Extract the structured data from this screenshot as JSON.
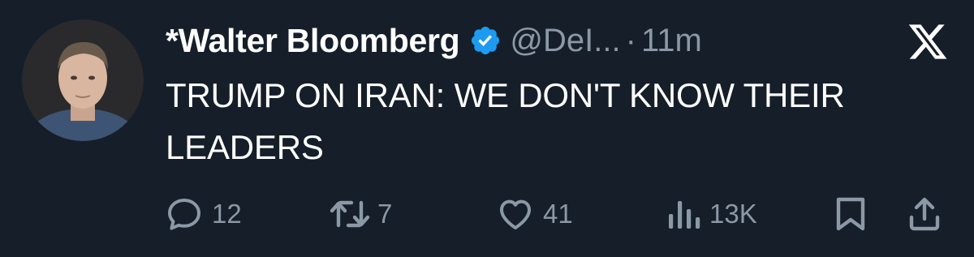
{
  "tweet": {
    "display_name": "*Walter Bloomberg",
    "handle": "@DeI...",
    "separator": "·",
    "time": "11m",
    "text": "TRUMP ON IRAN: WE DON'T KNOW THEIR LEADERS",
    "verified": true
  },
  "actions": {
    "replies": "12",
    "reposts": "7",
    "likes": "41",
    "views": "13K"
  },
  "icons": {
    "reply": "speech-bubble-icon",
    "repost": "repost-arrows-icon",
    "like": "heart-icon",
    "views": "bar-chart-icon",
    "bookmark": "bookmark-icon",
    "share": "share-upload-icon",
    "platform": "x-logo-icon",
    "verified": "verified-badge-icon"
  },
  "colors": {
    "background": "#151e29",
    "text_primary": "#ffffff",
    "text_secondary": "#8b98a5",
    "verified_blue": "#1d9bf0"
  }
}
